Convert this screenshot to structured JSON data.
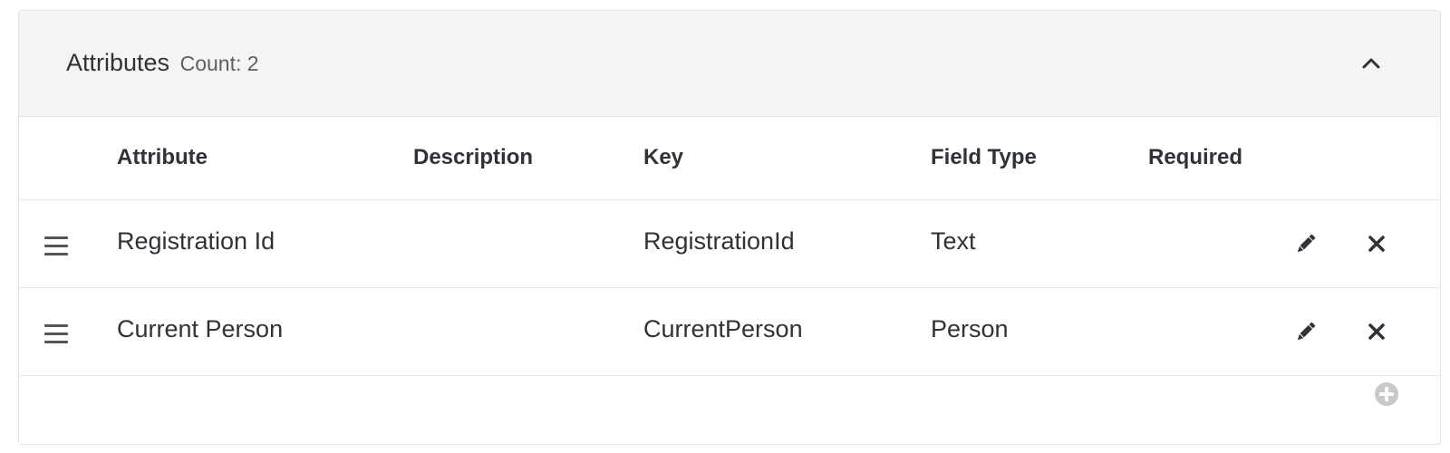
{
  "panel": {
    "title": "Attributes",
    "count_label": "Count: 2"
  },
  "table": {
    "columns": {
      "attribute": "Attribute",
      "description": "Description",
      "key": "Key",
      "field_type": "Field Type",
      "required": "Required"
    },
    "rows": [
      {
        "attribute": "Registration Id",
        "description": "",
        "key": "RegistrationId",
        "field_type": "Text",
        "required": ""
      },
      {
        "attribute": "Current Person",
        "description": "",
        "key": "CurrentPerson",
        "field_type": "Person",
        "required": ""
      }
    ]
  },
  "icons": {
    "collapse": "chevron-up-icon",
    "drag": "bars-icon",
    "edit": "pencil-icon",
    "delete": "times-icon",
    "add": "plus-circle-icon"
  },
  "colors": {
    "header_bg": "#f4f4f4",
    "text": "#2f3237",
    "border": "#e3e3e3",
    "add_icon": "#c8c8c8"
  }
}
